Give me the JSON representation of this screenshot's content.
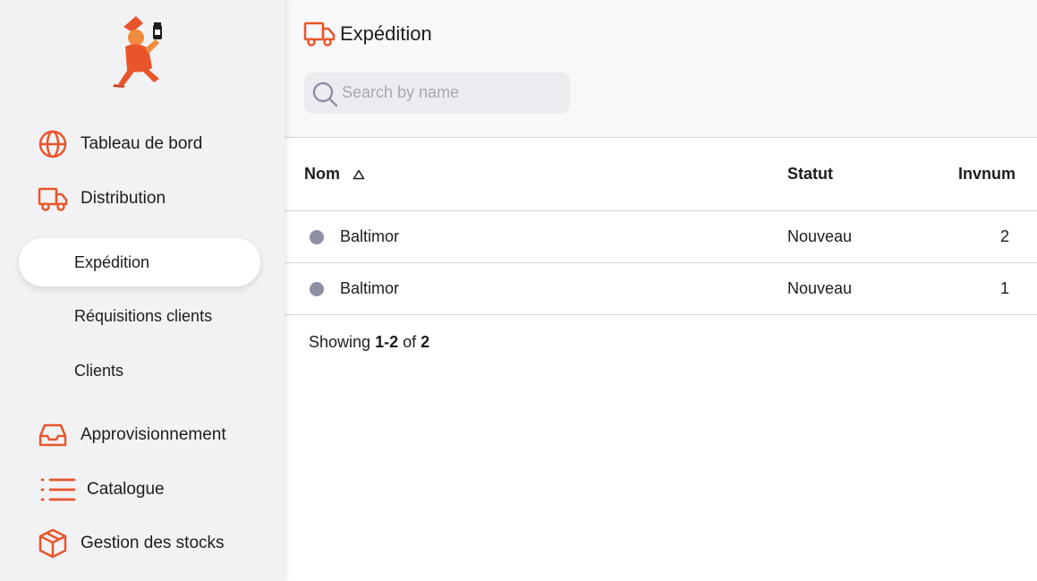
{
  "sidebar": {
    "logo": "pharmacist-mascot-logo",
    "items": [
      {
        "label": "Tableau de bord",
        "icon": "globe-icon"
      },
      {
        "label": "Distribution",
        "icon": "truck-icon"
      },
      {
        "label": "Approvisionnement",
        "icon": "inbox-icon"
      },
      {
        "label": "Catalogue",
        "icon": "list-icon"
      },
      {
        "label": "Gestion des stocks",
        "icon": "box-icon"
      }
    ],
    "sub_items": [
      {
        "label": "Expédition",
        "active": true
      },
      {
        "label": "Réquisitions clients",
        "active": false
      },
      {
        "label": "Clients",
        "active": false
      }
    ]
  },
  "header": {
    "title": "Expédition",
    "title_icon": "truck-icon",
    "search_placeholder": "Search by name",
    "search_value": ""
  },
  "table": {
    "columns": {
      "nom": "Nom",
      "statut": "Statut",
      "invnum": "Invnum"
    },
    "sort": {
      "column": "Nom",
      "direction": "ascending"
    },
    "rows": [
      {
        "name": "Baltimor",
        "statut": "Nouveau",
        "invnum": "2"
      },
      {
        "name": "Baltimor",
        "statut": "Nouveau",
        "invnum": "1"
      }
    ]
  },
  "footer": {
    "prefix": "Showing",
    "range": "1-2",
    "of": "of",
    "total": "2"
  },
  "colors": {
    "accent": "#e8552b",
    "sidebar_bg": "#f2f2f4",
    "header_bg": "#f8f8fa",
    "status_dot": "#8e8ea4",
    "border": "#d8d8dc"
  }
}
